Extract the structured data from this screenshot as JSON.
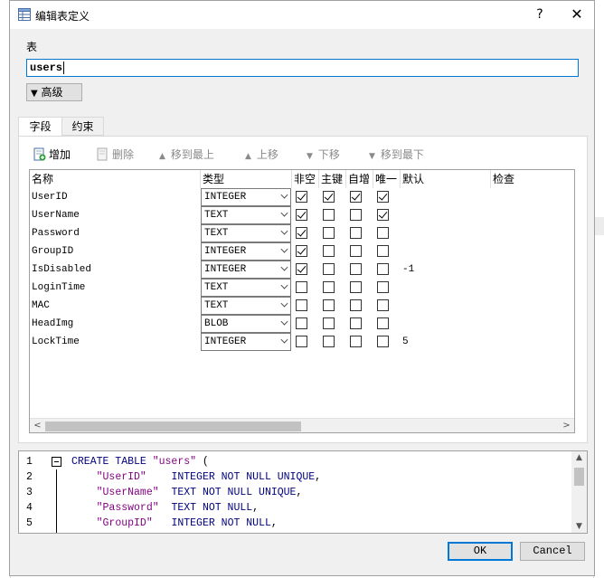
{
  "dialog": {
    "title": "编辑表定义",
    "help_glyph": "?",
    "close_glyph": "✕"
  },
  "table": {
    "label": "表",
    "name": "users",
    "advanced_label": "高级"
  },
  "tabs": [
    {
      "label": "字段",
      "active": true
    },
    {
      "label": "约束",
      "active": false
    }
  ],
  "toolbar": {
    "add": "增加",
    "delete": "删除",
    "move_top": "移到最上",
    "move_up": "上移",
    "move_down": "下移",
    "move_bottom": "移到最下"
  },
  "columns": {
    "name": "名称",
    "type": "类型",
    "not_null": "非空",
    "pk": "主键",
    "autoinc": "自增",
    "unique": "唯一",
    "default": "默认",
    "check": "检查"
  },
  "fields": [
    {
      "name": "UserID",
      "type": "INTEGER",
      "not_null": true,
      "pk": true,
      "autoinc": true,
      "unique": true,
      "default": ""
    },
    {
      "name": "UserName",
      "type": "TEXT",
      "not_null": true,
      "pk": false,
      "autoinc": false,
      "unique": true,
      "default": ""
    },
    {
      "name": "Password",
      "type": "TEXT",
      "not_null": true,
      "pk": false,
      "autoinc": false,
      "unique": false,
      "default": ""
    },
    {
      "name": "GroupID",
      "type": "INTEGER",
      "not_null": true,
      "pk": false,
      "autoinc": false,
      "unique": false,
      "default": ""
    },
    {
      "name": "IsDisabled",
      "type": "INTEGER",
      "not_null": true,
      "pk": false,
      "autoinc": false,
      "unique": false,
      "default": "-1"
    },
    {
      "name": "LoginTime",
      "type": "TEXT",
      "not_null": false,
      "pk": false,
      "autoinc": false,
      "unique": false,
      "default": ""
    },
    {
      "name": "MAC",
      "type": "TEXT",
      "not_null": false,
      "pk": false,
      "autoinc": false,
      "unique": false,
      "default": ""
    },
    {
      "name": "HeadImg",
      "type": "BLOB",
      "not_null": false,
      "pk": false,
      "autoinc": false,
      "unique": false,
      "default": ""
    },
    {
      "name": "LockTime",
      "type": "INTEGER",
      "not_null": false,
      "pk": false,
      "autoinc": false,
      "unique": false,
      "default": "5"
    }
  ],
  "sql": {
    "lines": [
      {
        "num": "1",
        "parts": [
          [
            "kw",
            "CREATE TABLE "
          ],
          [
            "str",
            "\"users\""
          ],
          [
            "",
            " ("
          ]
        ]
      },
      {
        "num": "2",
        "parts": [
          [
            "",
            "    "
          ],
          [
            "str",
            "\"UserID\""
          ],
          [
            "",
            "    "
          ],
          [
            "kw",
            "INTEGER NOT NULL UNIQUE"
          ],
          [
            "",
            ","
          ]
        ]
      },
      {
        "num": "3",
        "parts": [
          [
            "",
            "    "
          ],
          [
            "str",
            "\"UserName\""
          ],
          [
            "",
            "  "
          ],
          [
            "kw",
            "TEXT NOT NULL UNIQUE"
          ],
          [
            "",
            ","
          ]
        ]
      },
      {
        "num": "4",
        "parts": [
          [
            "",
            "    "
          ],
          [
            "str",
            "\"Password\""
          ],
          [
            "",
            "  "
          ],
          [
            "kw",
            "TEXT NOT NULL"
          ],
          [
            "",
            ","
          ]
        ]
      },
      {
        "num": "5",
        "parts": [
          [
            "",
            "    "
          ],
          [
            "str",
            "\"GroupID\""
          ],
          [
            "",
            "   "
          ],
          [
            "kw",
            "INTEGER NOT NULL"
          ],
          [
            "",
            ","
          ]
        ]
      }
    ]
  },
  "buttons": {
    "ok": "OK",
    "cancel": "Cancel"
  },
  "colors": {
    "accent": "#0078d7",
    "sql_keyword": "#00007f",
    "sql_string": "#7f007f"
  }
}
